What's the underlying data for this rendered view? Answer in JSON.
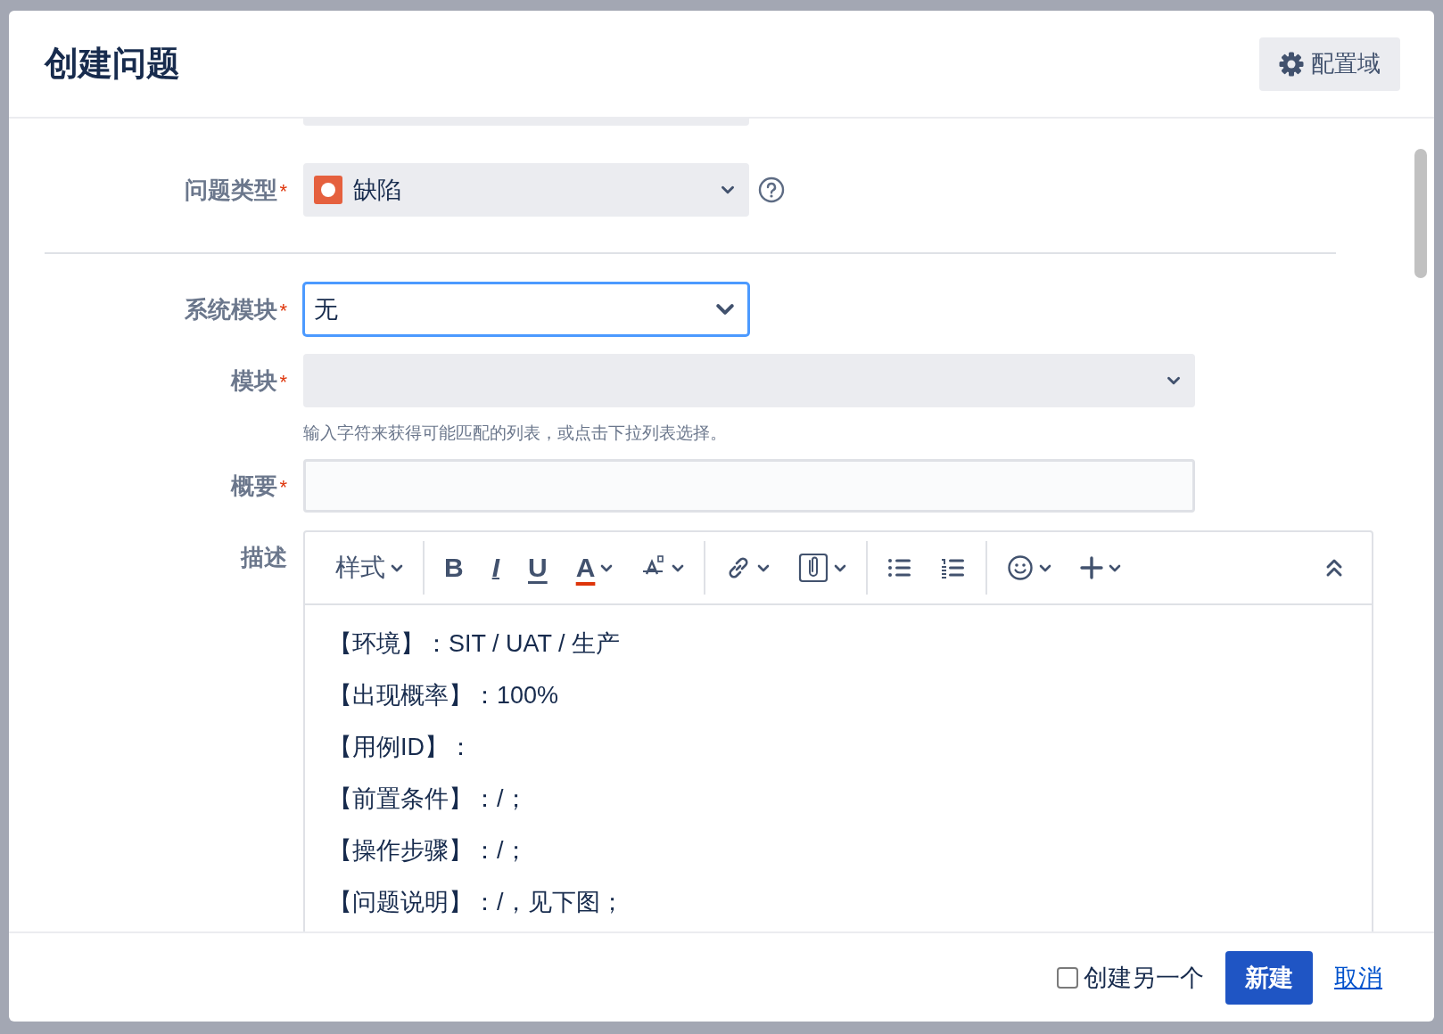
{
  "dialog": {
    "title": "创建问题",
    "config_button": "配置域"
  },
  "required_mark": "*",
  "fields": [
    {
      "kind": "issue-type",
      "label": "问题类型",
      "required": true,
      "value": "缺陷"
    },
    {
      "kind": "select",
      "label": "系统模块",
      "required": true,
      "value": "无",
      "focused": true
    },
    {
      "kind": "select-wide",
      "label": "模块",
      "required": true,
      "hint": "输入字符来获得可能匹配的列表，或点击下拉列表选择。"
    },
    {
      "kind": "text",
      "label": "概要",
      "required": true
    },
    {
      "kind": "editor",
      "label": "描述",
      "required": false,
      "toolbar": [
        [
          {
            "kind": "style-menu",
            "text": "样式",
            "dropdown": true
          }
        ],
        [
          {
            "kind": "bold",
            "text": "B",
            "dropdown": false
          },
          {
            "kind": "italic",
            "text": "I",
            "dropdown": false
          },
          {
            "kind": "underline",
            "text": "U",
            "dropdown": false
          },
          {
            "kind": "color",
            "text": "A",
            "dropdown": true
          },
          {
            "kind": "format",
            "dropdown": true
          }
        ],
        [
          {
            "kind": "link",
            "dropdown": true
          },
          {
            "kind": "attach",
            "dropdown": true
          }
        ],
        [
          {
            "kind": "bullets",
            "dropdown": false
          },
          {
            "kind": "numbers",
            "dropdown": false
          }
        ],
        [
          {
            "kind": "emoji",
            "dropdown": true
          },
          {
            "kind": "insert",
            "dropdown": true
          }
        ]
      ],
      "lines": [
        "【环境】：SIT / UAT / 生产",
        "【出现概率】：100%",
        "【用例ID】：",
        "【前置条件】：/；",
        "【操作步骤】：/；",
        "【问题说明】：/，见下图；"
      ]
    }
  ],
  "footer": {
    "create_another": {
      "label": "创建另一个",
      "checked": false
    },
    "submit": "新建",
    "cancel": "取消"
  }
}
